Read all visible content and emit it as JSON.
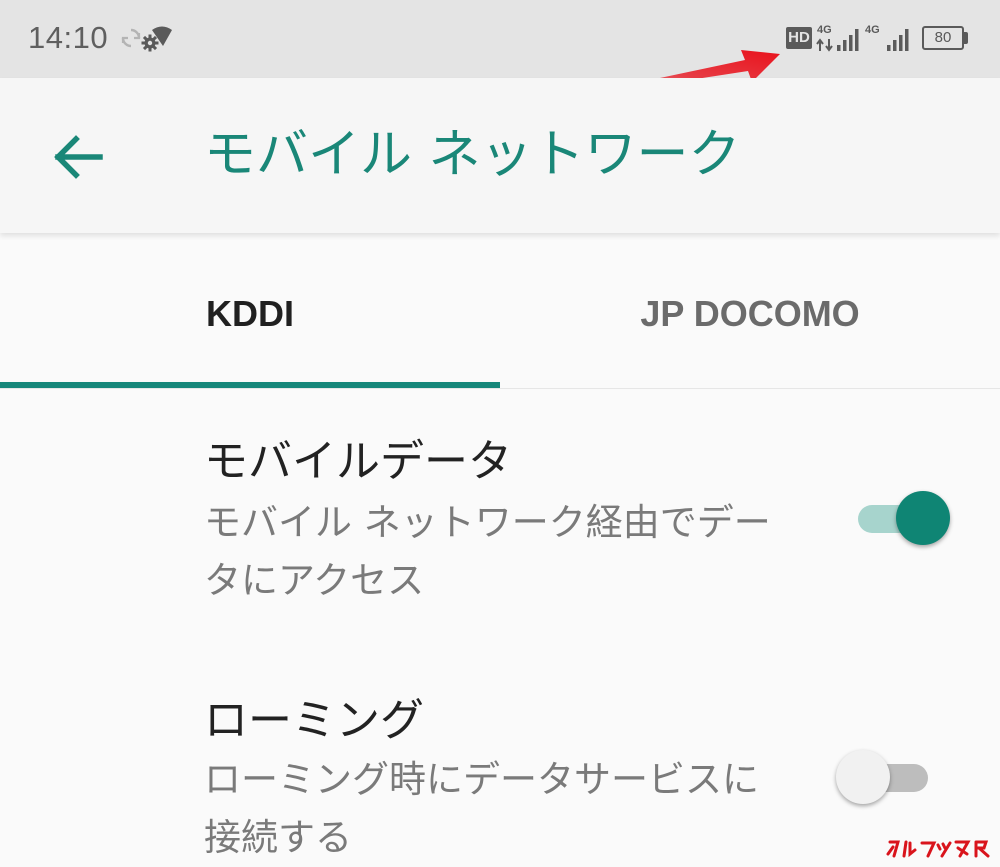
{
  "status_bar": {
    "time": "14:10",
    "hd_label": "HD",
    "network_1": "4G",
    "network_2": "4G",
    "battery_level": "80"
  },
  "app_bar": {
    "title": "モバイル ネットワーク"
  },
  "tabs": [
    {
      "label": "KDDI",
      "selected": true
    },
    {
      "label": "JP DOCOMO",
      "selected": false
    }
  ],
  "settings": [
    {
      "title": "モバイルデータ",
      "summary": "モバイル ネットワーク経由でデータにアクセス",
      "enabled": true
    },
    {
      "title": "ローミング",
      "summary": "ローミング時にデータサービスに接続する",
      "enabled": false
    }
  ],
  "colors": {
    "accent": "#17877a",
    "switch_on_thumb": "#0f8574",
    "annotation_arrow": "#e8121c"
  },
  "icons": {
    "back": "arrow-left-icon",
    "sync": "sync-icon",
    "gear": "gear-icon",
    "wifi": "wifi-icon",
    "signal": "signal-icon",
    "battery": "battery-icon"
  }
}
